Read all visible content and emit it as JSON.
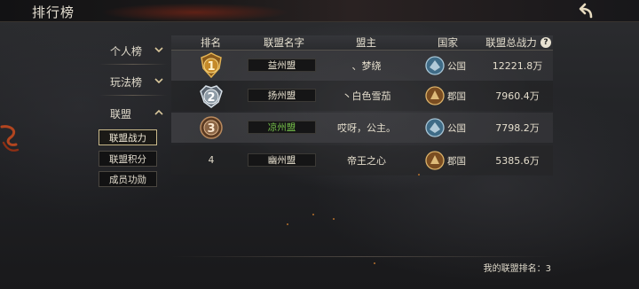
{
  "header": {
    "title": "排行榜",
    "back_icon": "back-arrow-icon"
  },
  "nav": {
    "items": [
      {
        "label": "个人榜",
        "chevron": "chevron-down-icon"
      },
      {
        "label": "玩法榜",
        "chevron": "chevron-down-icon"
      },
      {
        "label": "联盟",
        "chevron": "chevron-up-icon"
      }
    ],
    "sub_items": [
      {
        "label": "联盟战力",
        "active": true
      },
      {
        "label": "联盟积分",
        "active": false
      },
      {
        "label": "成员功勋",
        "active": false
      }
    ]
  },
  "table": {
    "headers": {
      "rank": "排名",
      "alliance_name": "联盟名字",
      "leader": "盟主",
      "nation": "国家",
      "power": "联盟总战力"
    },
    "rows": [
      {
        "rank": "1",
        "badge": "gold-rank-badge",
        "alliance": "益州盟",
        "leader": "、梦绕",
        "nation": "公国",
        "nation_emblem": "blue-nation-emblem",
        "power": "12221.8万"
      },
      {
        "rank": "2",
        "badge": "silver-rank-badge",
        "alliance": "扬州盟",
        "leader": "丶白色雪茄",
        "nation": "郡国",
        "nation_emblem": "gold-nation-emblem",
        "power": "7960.4万"
      },
      {
        "rank": "3",
        "badge": "bronze-rank-badge",
        "alliance": "凉州盟",
        "leader": "哎呀，公主。",
        "nation": "公国",
        "nation_emblem": "blue-nation-emblem",
        "power": "7798.2万",
        "highlight": true
      },
      {
        "rank": "4",
        "badge": "",
        "alliance": "幽州盟",
        "leader": "帝王之心",
        "nation": "郡国",
        "nation_emblem": "gold-nation-emblem",
        "power": "5385.6万"
      }
    ]
  },
  "footer": {
    "my_rank": "我的联盟排名：3"
  },
  "colors": {
    "highlight_green": "#79c64c",
    "gold": "#d9c79c"
  }
}
